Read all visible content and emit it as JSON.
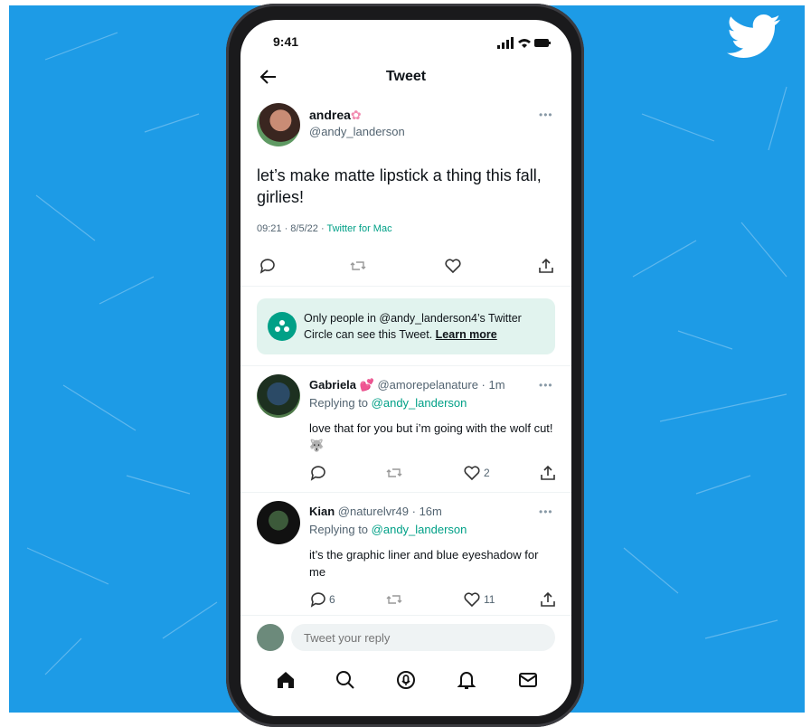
{
  "status": {
    "time": "9:41"
  },
  "header": {
    "title": "Tweet"
  },
  "original": {
    "name": "andrea",
    "handle": "@andy_landerson",
    "text": "let’s make matte lipstick a thing this fall, girlies!",
    "time": "09:21 · 8/5/22 · ",
    "source": "Twitter for Mac"
  },
  "circle_notice": {
    "text": "Only people in @andy_landerson4’s Twitter Circle can see this Tweet. ",
    "link": "Learn more"
  },
  "replies": [
    {
      "name": "Gabriela",
      "emoji": "💕",
      "handle_time": " @amorepelanature · 1m",
      "replying_prefix": "Replying to ",
      "replying_handle": "@andy_landerson",
      "text": "love that for you but i’m going with the wolf cut! 🐺",
      "reply_count": "",
      "like_count": "2"
    },
    {
      "name": "Kian",
      "emoji": "",
      "handle_time": " @naturelvr49 · 16m",
      "replying_prefix": "Replying to ",
      "replying_handle": "@andy_landerson",
      "text": "it’s the graphic liner and blue eyeshadow for me",
      "reply_count": "6",
      "like_count": "11"
    }
  ],
  "compose": {
    "placeholder": "Tweet your reply"
  },
  "colors": {
    "background": "#1d9be6",
    "circle_green": "#00a087",
    "circle_bg": "#e1f3ee"
  },
  "icons": {
    "back": "arrow-left-icon",
    "nav": [
      "home-icon",
      "search-icon",
      "spaces-icon",
      "notifications-icon",
      "messages-icon"
    ]
  }
}
